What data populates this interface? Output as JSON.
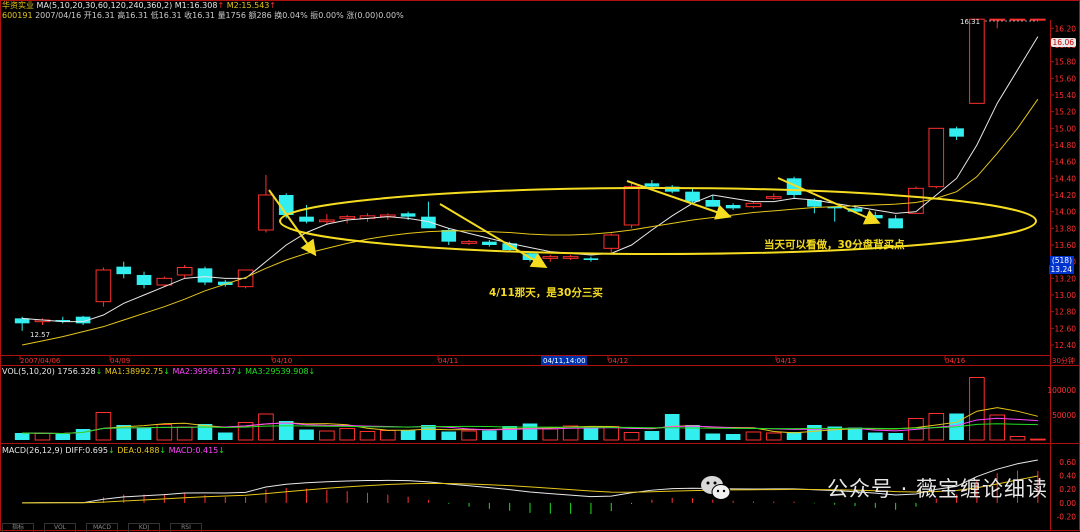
{
  "header": {
    "stock_name": "华资实业",
    "ma_params": "MA(5,10,20,30,60,120,240,360,2)",
    "ma1": "M1:16.308",
    "ma2": "M2:15.543",
    "code": "600191",
    "date_label": "2007/04/16",
    "open": "开16.31",
    "high": "高16.31",
    "low": "低16.31",
    "close": "收16.31",
    "volume": "量1756",
    "amount": "额286",
    "turnover": "换0.04%",
    "amplitude": "振0.00%",
    "change": "涨(0.00)0.00%"
  },
  "price_axis": {
    "labels": [
      "16.20",
      "16.00",
      "15.80",
      "15.60",
      "15.40",
      "15.20",
      "15.00",
      "14.80",
      "14.60",
      "14.40",
      "14.20",
      "14.00",
      "13.80",
      "13.60",
      "13.40",
      "13.20",
      "13.00",
      "12.80",
      "12.60",
      "12.40"
    ],
    "current_price_badge": "16.06",
    "cursor_badge_top": "(518)",
    "cursor_badge_bottom": "13.24",
    "low_marker": "12.57",
    "high_marker": "16.31"
  },
  "time_axis": {
    "labels": [
      "2007/04/06",
      "04/09",
      "04/10",
      "04/11",
      "04/11,14:00",
      "04/12",
      "04/13",
      "04/16"
    ],
    "period": "30分钟"
  },
  "volume_panel": {
    "label": "VOL(5,10,20)",
    "value": "1756.328",
    "ma1": "MA1:38992.75",
    "ma2": "MA2:39596.137",
    "ma3": "MA3:29539.908",
    "axis_labels": [
      "100000",
      "50000"
    ]
  },
  "macd_panel": {
    "label": "MACD(26,12,9)",
    "diff": "DIFF:0.695",
    "dea": "DEA:0.488",
    "macd": "MACD:0.415",
    "axis_labels": [
      "0.60",
      "0.40",
      "0.20",
      "0.00",
      "-0.20"
    ]
  },
  "annotations": {
    "a1": "4/11那天，是30分三买",
    "a2": "当天可以看做，30分盘背买点"
  },
  "watermark": "公众号 · 薇宝缠论细读",
  "bottom_tabs": [
    "指标",
    "VOL",
    "MACD",
    "KDJ",
    "RSI"
  ],
  "colors": {
    "up": "#ff3030",
    "down": "#33eeee",
    "ma_white": "#e8e8e8",
    "ma_yellow": "#e6c619",
    "annotation": "#f5dc20",
    "axis": "#ff3030"
  },
  "chart_data": {
    "type": "candlestick",
    "timeframe": "30分钟",
    "candles": [
      {
        "o": 12.72,
        "h": 12.74,
        "l": 12.57,
        "c": 12.66
      },
      {
        "o": 12.68,
        "h": 12.72,
        "l": 12.64,
        "c": 12.7
      },
      {
        "o": 12.7,
        "h": 12.74,
        "l": 12.66,
        "c": 12.68
      },
      {
        "o": 12.74,
        "h": 12.75,
        "l": 12.64,
        "c": 12.66
      },
      {
        "o": 12.92,
        "h": 13.33,
        "l": 12.86,
        "c": 13.3
      },
      {
        "o": 13.34,
        "h": 13.4,
        "l": 13.2,
        "c": 13.25
      },
      {
        "o": 13.24,
        "h": 13.28,
        "l": 13.08,
        "c": 13.12
      },
      {
        "o": 13.12,
        "h": 13.22,
        "l": 13.1,
        "c": 13.2
      },
      {
        "o": 13.24,
        "h": 13.36,
        "l": 13.2,
        "c": 13.33
      },
      {
        "o": 13.32,
        "h": 13.34,
        "l": 13.12,
        "c": 13.15
      },
      {
        "o": 13.16,
        "h": 13.18,
        "l": 13.1,
        "c": 13.12
      },
      {
        "o": 13.1,
        "h": 13.3,
        "l": 13.08,
        "c": 13.3
      },
      {
        "o": 13.78,
        "h": 14.44,
        "l": 13.75,
        "c": 14.2
      },
      {
        "o": 14.2,
        "h": 14.22,
        "l": 13.92,
        "c": 13.96
      },
      {
        "o": 13.94,
        "h": 14.08,
        "l": 13.86,
        "c": 13.88
      },
      {
        "o": 13.88,
        "h": 13.97,
        "l": 13.84,
        "c": 13.9
      },
      {
        "o": 13.92,
        "h": 13.96,
        "l": 13.86,
        "c": 13.94
      },
      {
        "o": 13.92,
        "h": 13.98,
        "l": 13.88,
        "c": 13.95
      },
      {
        "o": 13.94,
        "h": 13.98,
        "l": 13.9,
        "c": 13.96
      },
      {
        "o": 13.98,
        "h": 14.0,
        "l": 13.9,
        "c": 13.94
      },
      {
        "o": 13.94,
        "h": 14.12,
        "l": 13.8,
        "c": 13.8
      },
      {
        "o": 13.78,
        "h": 13.8,
        "l": 13.6,
        "c": 13.64
      },
      {
        "o": 13.62,
        "h": 13.66,
        "l": 13.6,
        "c": 13.64
      },
      {
        "o": 13.64,
        "h": 13.66,
        "l": 13.58,
        "c": 13.6
      },
      {
        "o": 13.62,
        "h": 13.64,
        "l": 13.52,
        "c": 13.54
      },
      {
        "o": 13.5,
        "h": 13.52,
        "l": 13.4,
        "c": 13.42
      },
      {
        "o": 13.44,
        "h": 13.48,
        "l": 13.4,
        "c": 13.46
      },
      {
        "o": 13.44,
        "h": 13.48,
        "l": 13.42,
        "c": 13.46
      },
      {
        "o": 13.44,
        "h": 13.46,
        "l": 13.4,
        "c": 13.42
      },
      {
        "o": 13.56,
        "h": 13.74,
        "l": 13.5,
        "c": 13.72
      },
      {
        "o": 13.84,
        "h": 14.34,
        "l": 13.8,
        "c": 14.3
      },
      {
        "o": 14.34,
        "h": 14.38,
        "l": 14.28,
        "c": 14.3
      },
      {
        "o": 14.3,
        "h": 14.32,
        "l": 14.22,
        "c": 14.24
      },
      {
        "o": 14.24,
        "h": 14.28,
        "l": 14.1,
        "c": 14.12
      },
      {
        "o": 14.14,
        "h": 14.2,
        "l": 14.06,
        "c": 14.06
      },
      {
        "o": 14.08,
        "h": 14.1,
        "l": 14.02,
        "c": 14.04
      },
      {
        "o": 14.06,
        "h": 14.12,
        "l": 14.04,
        "c": 14.1
      },
      {
        "o": 14.16,
        "h": 14.22,
        "l": 14.14,
        "c": 14.18
      },
      {
        "o": 14.4,
        "h": 14.42,
        "l": 14.16,
        "c": 14.2
      },
      {
        "o": 14.14,
        "h": 14.16,
        "l": 13.98,
        "c": 14.06
      },
      {
        "o": 14.06,
        "h": 14.06,
        "l": 13.88,
        "c": 14.04
      },
      {
        "o": 14.04,
        "h": 14.08,
        "l": 13.98,
        "c": 14.0
      },
      {
        "o": 13.96,
        "h": 14.0,
        "l": 13.9,
        "c": 13.92
      },
      {
        "o": 13.92,
        "h": 13.96,
        "l": 13.8,
        "c": 13.8
      },
      {
        "o": 13.98,
        "h": 14.3,
        "l": 13.98,
        "c": 14.28
      },
      {
        "o": 14.3,
        "h": 15.0,
        "l": 14.28,
        "c": 15.0
      },
      {
        "o": 15.0,
        "h": 15.02,
        "l": 14.86,
        "c": 14.9
      },
      {
        "o": 15.3,
        "h": 16.31,
        "l": 15.3,
        "c": 16.31
      },
      {
        "o": 16.31,
        "h": 16.31,
        "l": 16.2,
        "c": 16.31
      },
      {
        "o": 16.31,
        "h": 16.31,
        "l": 16.31,
        "c": 16.31
      },
      {
        "o": 16.31,
        "h": 16.31,
        "l": 16.31,
        "c": 16.31
      }
    ],
    "volume": [
      14000,
      13000,
      12000,
      22000,
      55000,
      30000,
      25000,
      31000,
      26000,
      32000,
      15000,
      35000,
      52000,
      38000,
      21000,
      18000,
      23000,
      17000,
      19000,
      20000,
      30000,
      17000,
      18000,
      19000,
      28000,
      33000,
      22000,
      28000,
      25000,
      27000,
      15000,
      18000,
      52000,
      30000,
      13000,
      12000,
      16000,
      14000,
      16000,
      30000,
      27000,
      25000,
      15000,
      14000,
      43000,
      53000,
      53000,
      125000,
      50000,
      7000,
      1756
    ],
    "ma5": [
      12.72,
      12.7,
      12.68,
      12.68,
      12.76,
      12.9,
      13.0,
      13.1,
      13.2,
      13.22,
      13.2,
      13.2,
      13.4,
      13.6,
      13.75,
      13.85,
      13.9,
      13.92,
      13.94,
      13.92,
      13.88,
      13.8,
      13.74,
      13.68,
      13.62,
      13.57,
      13.52,
      13.5,
      13.48,
      13.5,
      13.6,
      13.78,
      13.95,
      14.1,
      14.2,
      14.16,
      14.12,
      14.12,
      14.16,
      14.14,
      14.1,
      14.06,
      14.02,
      13.98,
      14.0,
      14.2,
      14.4,
      14.8,
      15.3,
      15.7,
      16.1
    ],
    "ma_long": [
      12.4,
      12.45,
      12.5,
      12.56,
      12.62,
      12.7,
      12.78,
      12.86,
      12.95,
      13.05,
      13.13,
      13.21,
      13.32,
      13.42,
      13.5,
      13.56,
      13.62,
      13.67,
      13.71,
      13.74,
      13.76,
      13.77,
      13.77,
      13.76,
      13.75,
      13.73,
      13.72,
      13.72,
      13.73,
      13.75,
      13.78,
      13.82,
      13.86,
      13.9,
      13.93,
      13.96,
      13.99,
      14.01,
      14.03,
      14.05,
      14.06,
      14.07,
      14.08,
      14.09,
      14.11,
      14.16,
      14.24,
      14.42,
      14.7,
      15.0,
      15.35
    ]
  }
}
